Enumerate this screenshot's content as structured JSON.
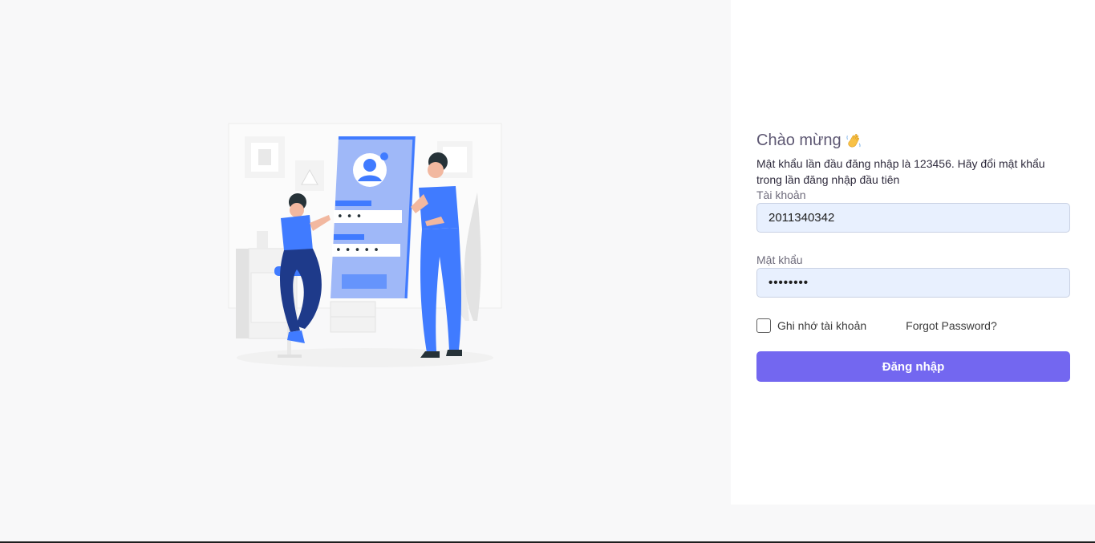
{
  "welcome": {
    "title": "Chào mừng",
    "icon": "waving-hand-icon",
    "subtitle": "Mật khẩu lần đầu đăng nhập là 123456. Hãy đổi mật khẩu trong lần đăng nhập đầu tiên"
  },
  "form": {
    "account_label": "Tài khoản",
    "account_value": "2011340342",
    "password_label": "Mật khẩu",
    "password_value": "••••••••",
    "remember_label": "Ghi nhớ tài khoản",
    "remember_checked": false,
    "forgot_label": "Forgot Password?",
    "submit_label": "Đăng nhập"
  },
  "illustration": {
    "icon": "login-illustration",
    "pin_dots": "• • •",
    "password_dots": "• • • • •"
  },
  "colors": {
    "primary": "#7367f0",
    "illustration_blue": "#407bff",
    "input_background": "#e8f0fe"
  }
}
